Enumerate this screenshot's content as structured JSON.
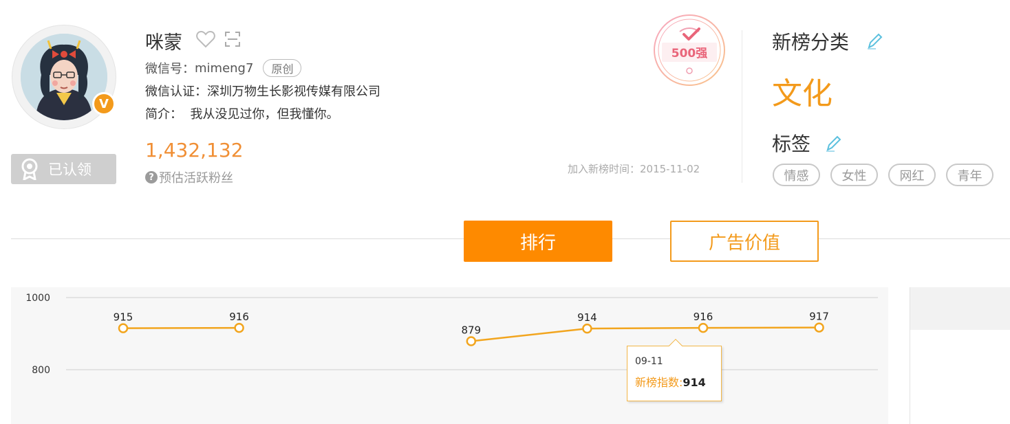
{
  "profile": {
    "name": "咪蒙",
    "wechat_id_label": "微信号：",
    "wechat_id": "mimeng7",
    "original_tag": "原创",
    "certification": "微信认证：深圳万物生长影视传媒有限公司",
    "intro": "简介：  我从没见过你，但我懂你。",
    "verified_badge": "V",
    "claim_label": "已认领"
  },
  "fans": {
    "count": "1,432,132",
    "help_glyph": "?",
    "label": "预估活跃粉丝"
  },
  "join_time": "加入新榜时间：2015-11-02",
  "badge": {
    "top_label": "500强",
    "color": "#e9657a"
  },
  "category": {
    "title": "新榜分类",
    "value": "文化"
  },
  "tags_section": {
    "title": "标签",
    "items": [
      "情感",
      "女性",
      "网红",
      "青年"
    ]
  },
  "tabs": {
    "ranking": "排行",
    "ad_value": "广告价值"
  },
  "colors": {
    "accent": "#fe8a00",
    "line": "#f2a51e",
    "count": "#f08f35"
  },
  "chart_data": {
    "type": "line",
    "ylim": [
      750,
      1000
    ],
    "yticks": [
      1000,
      800
    ],
    "series": [
      {
        "values": [
          915,
          916,
          null,
          879,
          914,
          916,
          917
        ]
      }
    ],
    "tooltip": {
      "date": "09-11",
      "label": "新榜指数:",
      "value": "914"
    }
  }
}
